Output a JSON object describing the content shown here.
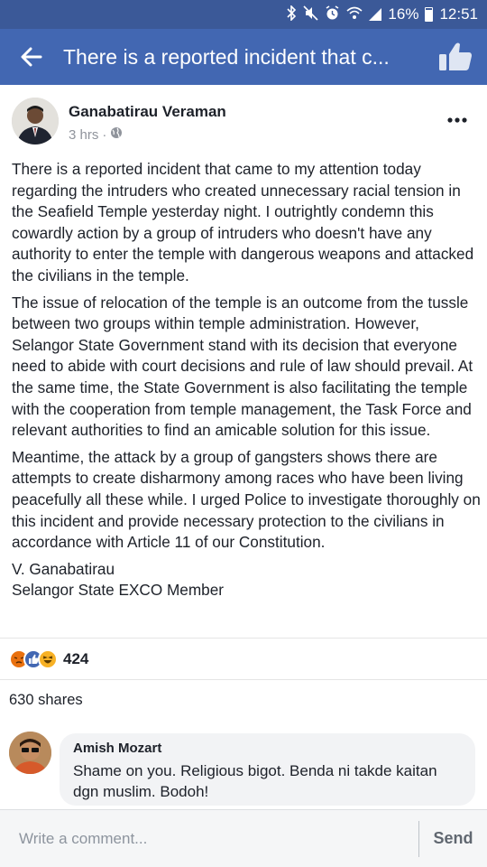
{
  "status_bar": {
    "battery": "16%",
    "time": "12:51",
    "icons": [
      "bluetooth-icon",
      "mute-icon",
      "alarm-icon",
      "wifi-icon",
      "signal-icon",
      "battery-icon"
    ]
  },
  "app_bar": {
    "title": "There is a reported incident that c...",
    "back_icon": "arrow-left-icon",
    "like_icon": "thumbs-up-icon"
  },
  "post": {
    "author": "Ganabatirau Veraman",
    "time": "3 hrs",
    "separator": "·",
    "audience_icon": "globe-icon",
    "more_icon": "ellipsis-icon",
    "paragraphs": [
      "There is a reported incident that came to my attention today regarding the intruders who created unnecessary racial tension in the Seafield Temple yesterday night. I outrightly condemn this cowardly action by a group of intruders who doesn't have any authority to enter the temple with dangerous weapons and attacked the civilians in the temple.",
      "The issue of relocation of the temple is an outcome from the tussle between two groups within temple administration. However, Selangor State Government stand with its decision that everyone need to abide with court decisions and rule of law should prevail. At the same time, the State Government is also facilitating the temple with the cooperation from temple management, the Task Force and relevant authorities to find an amicable solution for this issue.",
      "Meantime, the attack by a group of gangsters shows there are attempts to create disharmony among races who have been living peacefully all these while. I urged Police to investigate thoroughly on this incident and provide necessary protection to the civilians in accordance with Article 11 of our Constitution."
    ],
    "signature_name": "V. Ganabatirau",
    "signature_title": "Selangor State EXCO Member",
    "reactions": {
      "types": [
        "angry",
        "like",
        "haha"
      ],
      "count": "424",
      "colors": {
        "angry": "#e9710f",
        "like": "#4267b2",
        "haha": "#f7b125"
      }
    },
    "shares": "630 shares"
  },
  "comment": {
    "author": "Amish Mozart",
    "text": "Shame on you. Religious bigot. Benda ni takde kaitan dgn muslim. Bodoh!"
  },
  "composer": {
    "placeholder": "Write a comment...",
    "send_label": "Send"
  },
  "colors": {
    "status_bar": "#3b5998",
    "app_bar": "#4267b2",
    "background": "#e9ebee",
    "meta_text": "#90949c"
  }
}
